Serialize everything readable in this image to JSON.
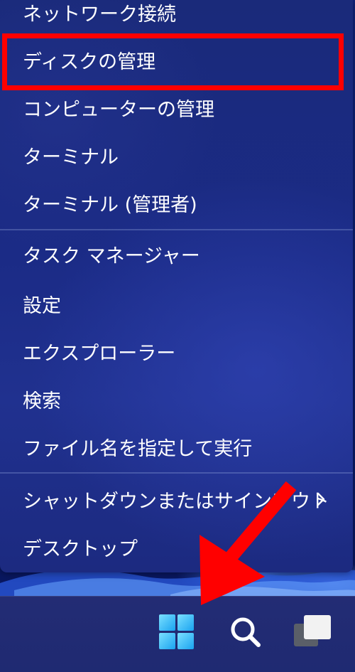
{
  "menu": {
    "items": [
      {
        "label": "ネットワーク接続"
      },
      {
        "label": "ディスクの管理"
      },
      {
        "label": "コンピューターの管理"
      },
      {
        "label": "ターミナル"
      },
      {
        "label": "ターミナル (管理者)"
      },
      {
        "label": "タスク マネージャー"
      },
      {
        "label": "設定"
      },
      {
        "label": "エクスプローラー"
      },
      {
        "label": "検索"
      },
      {
        "label": "ファイル名を指定して実行"
      },
      {
        "label": "シャットダウンまたはサインアウト"
      },
      {
        "label": "デスクトップ"
      }
    ],
    "submenu_chevron": "›"
  },
  "taskbar": {
    "icons": [
      "windows-start-icon",
      "search-icon",
      "task-view-icon"
    ]
  },
  "annotations": {
    "highlight_color": "#ff0000",
    "arrow_color": "#ff0000"
  },
  "colors": {
    "menu_background": "#1b2b86",
    "text": "#ffffff",
    "taskbar": "#232c74",
    "start_icon": "#4cc2ff"
  }
}
